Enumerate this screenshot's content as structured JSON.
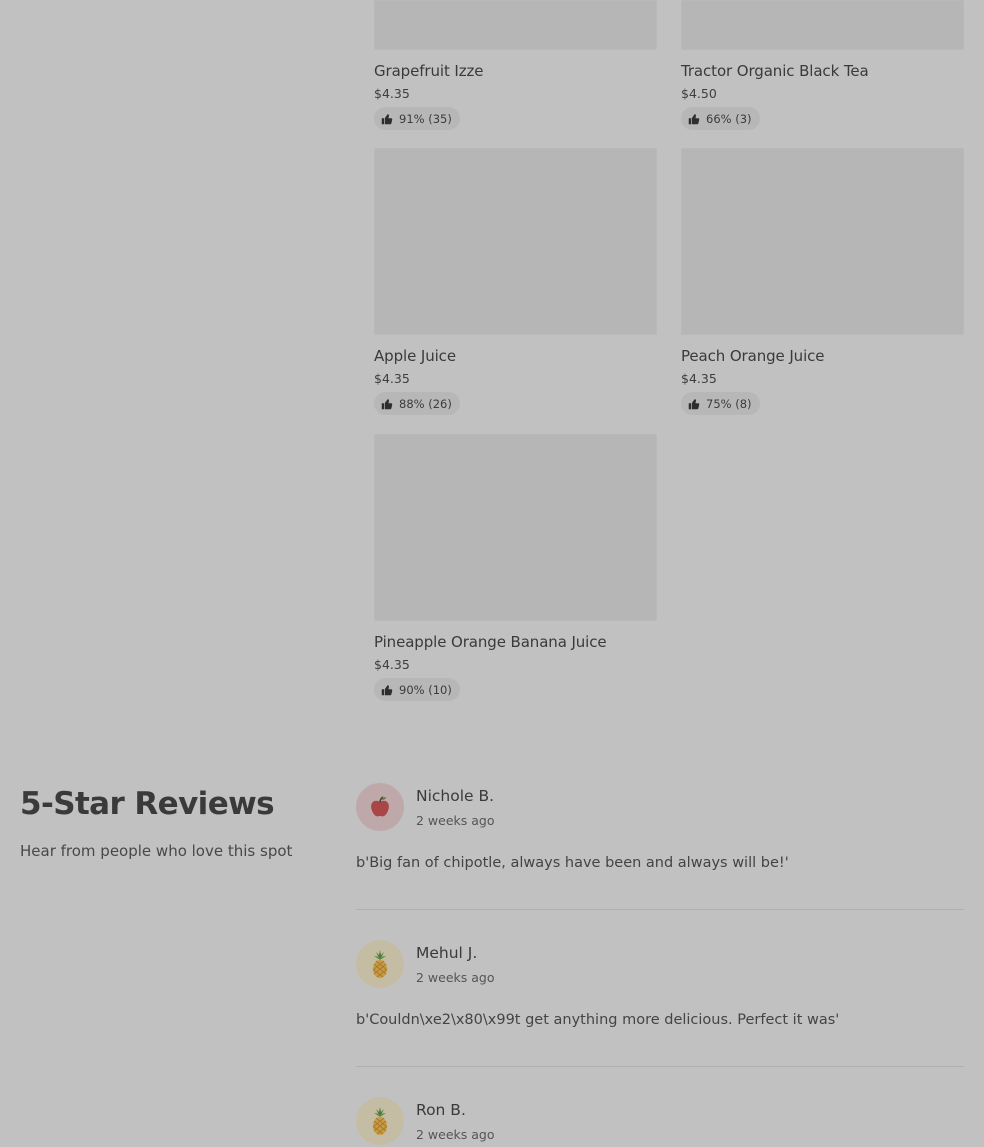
{
  "products": [
    {
      "name": "Grapefruit Izze",
      "price": "$4.35",
      "rating": "91% (35)"
    },
    {
      "name": "Tractor Organic Black Tea",
      "price": "$4.50",
      "rating": "66% (3)"
    },
    {
      "name": "Apple Juice",
      "price": "$4.35",
      "rating": "88% (26)"
    },
    {
      "name": "Peach Orange Juice",
      "price": "$4.35",
      "rating": "75% (8)"
    },
    {
      "name": "Pineapple Orange Banana Juice",
      "price": "$4.35",
      "rating": "90% (10)"
    }
  ],
  "reviews_section": {
    "title": "5-Star Reviews",
    "subtitle": "Hear from people who love this spot"
  },
  "reviews": [
    {
      "author": "Nichole B.",
      "time": "2 weeks ago",
      "avatar_icon": "apple-icon",
      "text": "b'Big fan of chipotle, always have been and always will be!'"
    },
    {
      "author": "Mehul J.",
      "time": "2 weeks ago",
      "avatar_icon": "pineapple-icon",
      "text": "b'Couldn\\xe2\\x80\\x99t get anything more delicious. Perfect it was'"
    },
    {
      "author": "Ron B.",
      "time": "2 weeks ago",
      "avatar_icon": "pineapple-icon",
      "text": ""
    }
  ],
  "colors": {
    "overlay_bg": "#c1c1c1",
    "image_placeholder": "#b6b6b6",
    "text": "#3a3a3a"
  }
}
